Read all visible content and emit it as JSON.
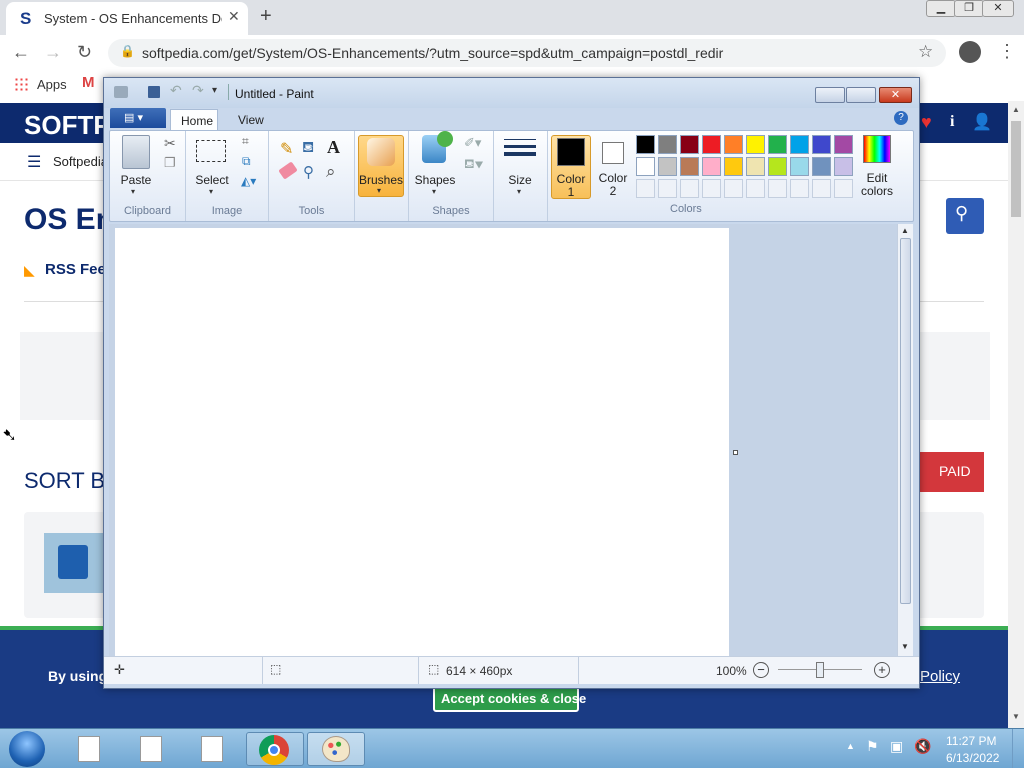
{
  "browser": {
    "tab_title": "System - OS Enhancements Dow",
    "tab_favicon": "S",
    "url": "softpedia.com/get/System/OS-Enhancements/?utm_source=spd&utm_campaign=postdl_redir",
    "bookmarks_apps": "Apps"
  },
  "site": {
    "logo": "SOFTP",
    "nav_label": "Softpedia",
    "heading": "OS En",
    "rss": "RSS Feed",
    "sort_by": "SORT BY",
    "paid_button": "PAID",
    "cookie_text": "By using t",
    "policy_link": "Policy",
    "cookie_button": "Accept cookies & close"
  },
  "paint": {
    "window_title": "Untitled - Paint",
    "tabs": [
      "Home",
      "View"
    ],
    "groups": {
      "clipboard": "Clipboard",
      "image": "Image",
      "tools": "Tools",
      "shapes": "Shapes",
      "colors": "Colors"
    },
    "buttons": {
      "paste": "Paste",
      "select": "Select",
      "brushes": "Brushes",
      "shapes": "Shapes",
      "size": "Size",
      "color1_line1": "Color",
      "color1_line2": "1",
      "color2_line1": "Color",
      "color2_line2": "2",
      "edit_colors_line1": "Edit",
      "edit_colors_line2": "colors"
    },
    "palette_row1": [
      "#000000",
      "#7f7f7f",
      "#880015",
      "#ed1c24",
      "#ff7f27",
      "#fff200",
      "#22b14c",
      "#00a2e8",
      "#3f48cc",
      "#a349a4"
    ],
    "palette_row2": [
      "#ffffff",
      "#c3c3c3",
      "#b97a57",
      "#ffaec9",
      "#ffc90e",
      "#efe4b0",
      "#b5e61d",
      "#99d9ea",
      "#7092be",
      "#c8bfe7"
    ],
    "color1": "#000000",
    "color2": "#ffffff",
    "status_size": "614 × 460px",
    "zoom": "100%"
  },
  "taskbar": {
    "time": "11:27 PM",
    "date": "6/13/2022"
  }
}
